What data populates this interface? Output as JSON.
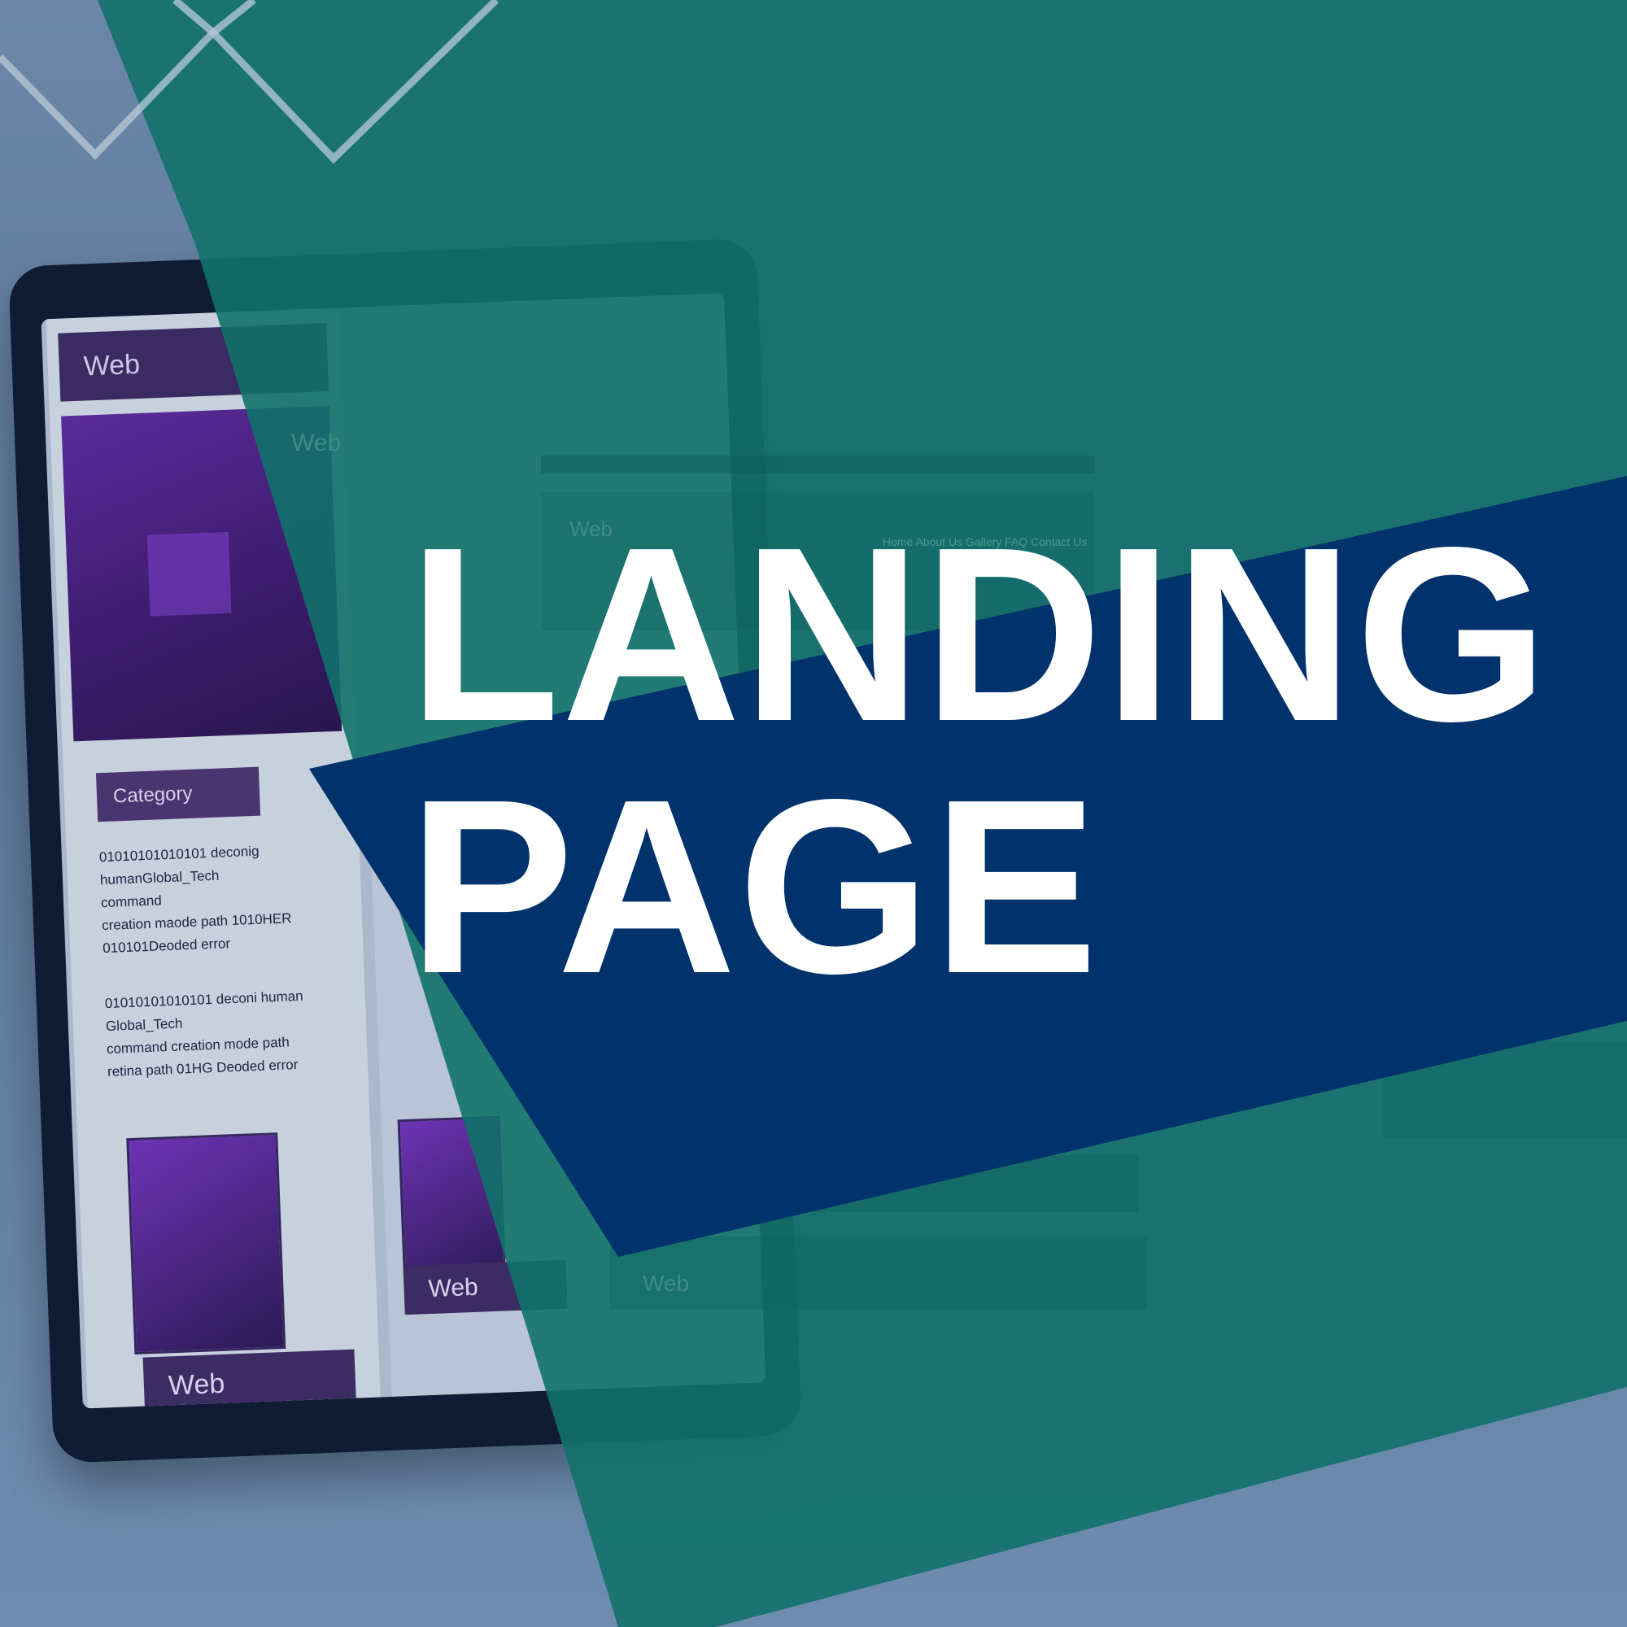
{
  "headline": {
    "line1": "LANDING",
    "line2": "PAGE"
  },
  "mockup": {
    "web_label": "Web",
    "category_label": "Category",
    "body_text_1": "01010101010101 deconig\nhumanGlobal_Tech\ncommand\ncreation maode path 1010HER\n010101Deoded error",
    "body_text_2": "01010101010101 deconi human\nGlobal_Tech\ncommand creation mode path\nretina path 01HG Deoded error",
    "nav_text": "Home  About Us  Gallery  FAQ  Contact Us"
  },
  "colors": {
    "background": "#5f7fa0",
    "teal_panel": "#1a6b6b",
    "navy_band": "#00336b",
    "headline_text": "#ffffff",
    "mockup_purple": "#3a2b62"
  }
}
